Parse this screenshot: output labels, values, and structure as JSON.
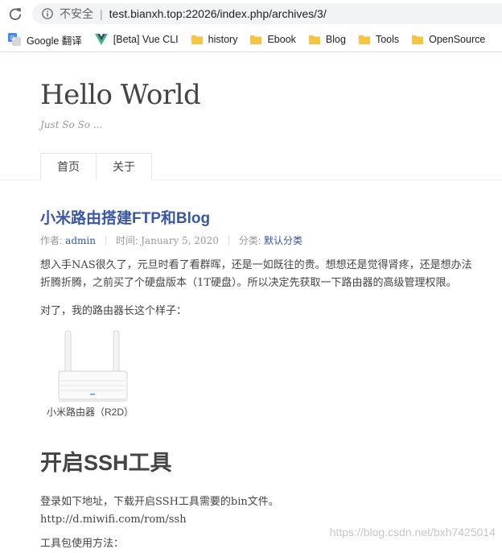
{
  "browser": {
    "security_label": "不安全",
    "separator": "|",
    "url": "test.bianxh.top:22026/index.php/archives/3/",
    "bookmarks": [
      {
        "icon": "google-translate-icon",
        "label": "Google 翻译"
      },
      {
        "icon": "vue-icon",
        "label": "[Beta] Vue CLI"
      },
      {
        "icon": "folder-icon",
        "label": "history"
      },
      {
        "icon": "folder-icon",
        "label": "Ebook"
      },
      {
        "icon": "folder-icon",
        "label": "Blog"
      },
      {
        "icon": "folder-icon",
        "label": "Tools"
      },
      {
        "icon": "folder-icon",
        "label": "OpenSource"
      }
    ]
  },
  "site": {
    "title": "Hello World",
    "tagline": "Just So So ...",
    "nav": [
      "首页",
      "关于"
    ]
  },
  "post": {
    "title": "小米路由搭建FTP和Blog",
    "meta": {
      "author_label": "作者:",
      "author": "admin",
      "time_label": "时间:",
      "time": "January 5, 2020",
      "category_label": "分类:",
      "category": "默认分类"
    },
    "p1_line1": "想入手NAS很久了，元旦时看了看群晖，还是一如既往的贵。想想还是觉得肾疼，还是想办法",
    "p1_line2": "折腾折腾，之前买了个硬盘版本（1T硬盘）。所以决定先获取一下路由器的高级管理权限。",
    "p2": "对了，我的路由器长这个样子：",
    "image_caption": "小米路由器（R2D）",
    "h2": "开启SSH工具",
    "p3_line1": "登录如下地址，下载开启SSH工具需要的bin文件。",
    "p3_line2": "http://d.miwifi.com/rom/ssh",
    "p4": "工具包使用方法："
  },
  "watermark": "https://blog.csdn.net/bxh7425014"
}
